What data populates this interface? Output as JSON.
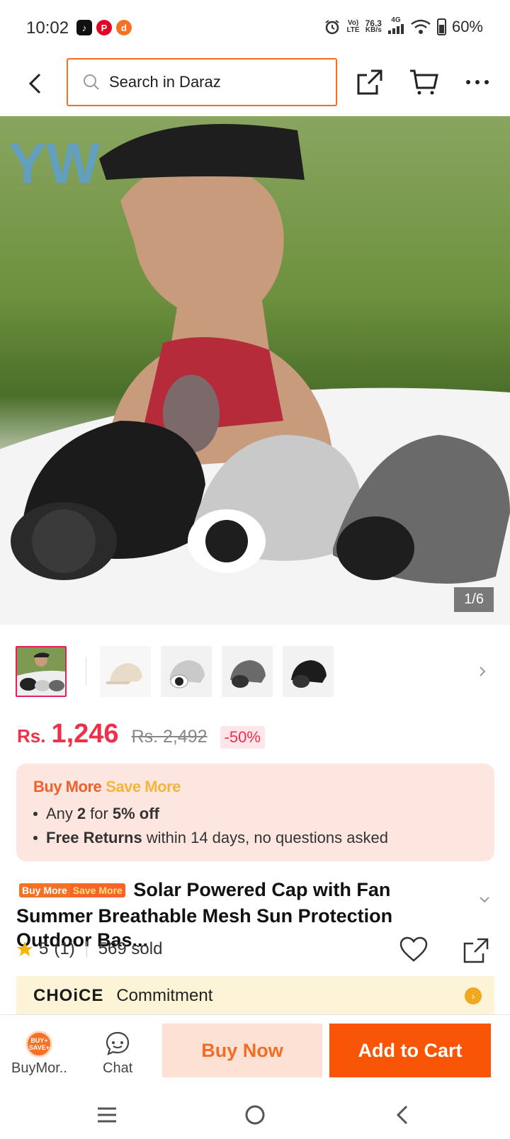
{
  "status_bar": {
    "time": "10:02",
    "net_speed": "76.3",
    "net_unit": "KB/s",
    "net_type": "4G",
    "volte": "Vo)",
    "lte": "LTE",
    "battery": "60%"
  },
  "header": {
    "search_placeholder": "Search in Daraz"
  },
  "hero": {
    "watermark": "YW",
    "counter": "1/6"
  },
  "price": {
    "currency": "Rs.",
    "current": "1,246",
    "original": "Rs. 2,492",
    "discount": "-50%"
  },
  "promo": {
    "title_part1": "Buy More",
    "title_part2": "Save More",
    "line1_pre": "Any",
    "line1_qty": "2",
    "line1_mid": "for",
    "line1_off": "5% off",
    "line2_bold": "Free Returns",
    "line2_rest": "within 14 days, no questions asked"
  },
  "product": {
    "badge_part1": "Buy More",
    "badge_part2": "Save More",
    "title": "Solar Powered Cap with Fan Summer Breathable Mesh Sun Protection Outdoor Bas..."
  },
  "rating": {
    "score": "5",
    "count": "(1)",
    "sold": "569 sold"
  },
  "choice": {
    "logo": "CHOiCE",
    "text": "Commitment"
  },
  "bottom_bar": {
    "buy_more_icon_text": "BUY+ SAVE+",
    "buy_more_label": "BuyMor..",
    "chat_label": "Chat",
    "buy_now": "Buy Now",
    "add_to_cart": "Add to Cart"
  },
  "colors": {
    "brand_orange": "#f85606",
    "price_red": "#f0304a"
  }
}
